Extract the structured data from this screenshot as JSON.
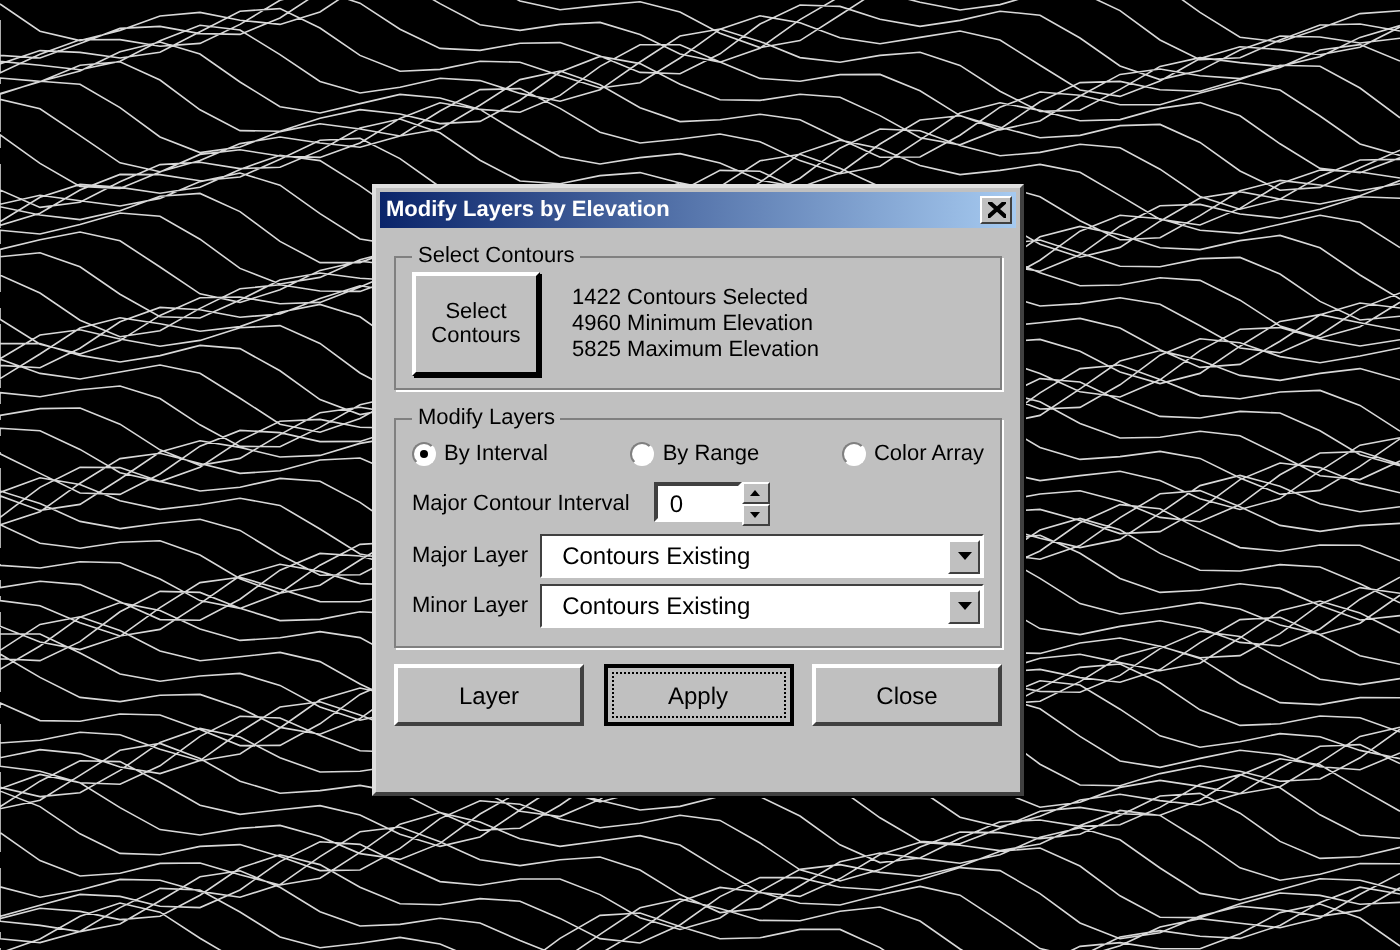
{
  "window": {
    "title": "Modify Layers by Elevation"
  },
  "select_contours": {
    "legend": "Select Contours",
    "button": "Select\nContours",
    "info": [
      "1422 Contours Selected",
      "4960 Minimum Elevation",
      "5825 Maximum Elevation"
    ]
  },
  "modify_layers": {
    "legend": "Modify Layers",
    "modes": [
      {
        "label": "By Interval",
        "selected": true
      },
      {
        "label": "By Range",
        "selected": false
      },
      {
        "label": "Color Array",
        "selected": false
      }
    ],
    "interval": {
      "label": "Major Contour Interval",
      "value": "0"
    },
    "major_layer": {
      "label": "Major Layer",
      "value": "Contours Existing"
    },
    "minor_layer": {
      "label": "Minor Layer",
      "value": "Contours Existing"
    }
  },
  "buttons": [
    {
      "label": "Layer",
      "focused": false
    },
    {
      "label": "Apply",
      "focused": true
    },
    {
      "label": "Close",
      "focused": false
    }
  ]
}
